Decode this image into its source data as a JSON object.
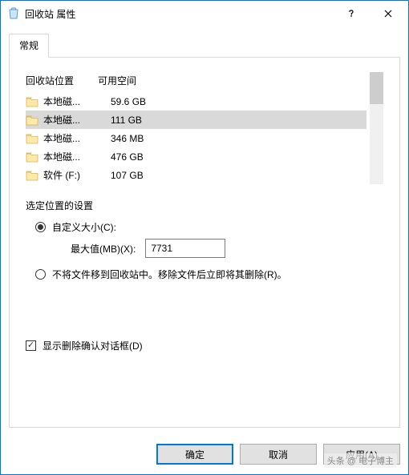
{
  "title": "回收站 属性",
  "tab": {
    "general": "常规"
  },
  "list": {
    "header_location": "回收站位置",
    "header_space": "可用空间",
    "rows": [
      {
        "loc": "本地磁...",
        "space": "59.6 GB",
        "selected": false
      },
      {
        "loc": "本地磁...",
        "space": "111 GB",
        "selected": true
      },
      {
        "loc": "本地磁...",
        "space": "346 MB",
        "selected": false
      },
      {
        "loc": "本地磁...",
        "space": "476 GB",
        "selected": false
      },
      {
        "loc": "软件 (F:)",
        "space": "107 GB",
        "selected": false
      }
    ]
  },
  "settings": {
    "section_label": "选定位置的设置",
    "custom_size_label": "自定义大小(C):",
    "max_label": "最大值(MB)(X):",
    "max_value": "7731",
    "no_recycle_label": "不将文件移到回收站中。移除文件后立即将其删除(R)。",
    "custom_checked": true,
    "confirm_label": "显示删除确认对话框(D)",
    "confirm_checked": true
  },
  "buttons": {
    "ok": "确定",
    "cancel": "取消",
    "apply": "应用(A)"
  },
  "watermark": "头条 @ 电子博主"
}
